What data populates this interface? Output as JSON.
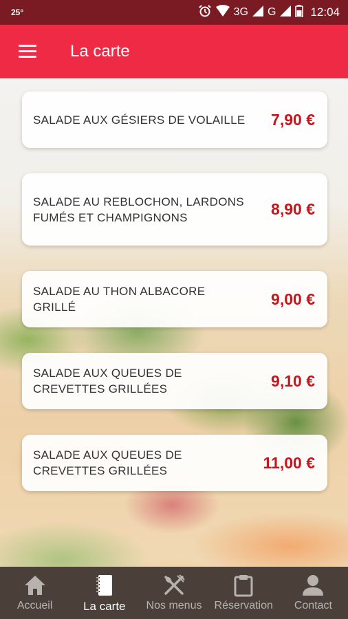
{
  "status_bar": {
    "temperature": "25°",
    "network_3g": "3G",
    "network_g": "G",
    "time": "12:04"
  },
  "app_bar": {
    "title": "La carte"
  },
  "menu_items": [
    {
      "name": "SALADE AUX GÉSIERS DE VOLAILLE",
      "price": "7,90 €"
    },
    {
      "name": "SALADE AU REBLOCHON, LARDONS FUMÉS ET CHAMPIGNONS",
      "price": "8,90 €"
    },
    {
      "name": "SALADE AU THON ALBACORE GRILLÉ",
      "price": "9,00 €"
    },
    {
      "name": "SALADE AUX QUEUES DE CREVETTES GRILLÉES",
      "price": "9,10 €"
    },
    {
      "name": "SALADE AUX QUEUES DE CREVETTES GRILLÉES",
      "price": "11,00 €"
    }
  ],
  "bottom_nav": [
    {
      "label": "Accueil",
      "icon": "home-icon",
      "active": false
    },
    {
      "label": "La carte",
      "icon": "notebook-icon",
      "active": true
    },
    {
      "label": "Nos menus",
      "icon": "cutlery-icon",
      "active": false
    },
    {
      "label": "Réservation",
      "icon": "clipboard-icon",
      "active": false
    },
    {
      "label": "Contact",
      "icon": "person-icon",
      "active": false
    }
  ],
  "colors": {
    "status_bar": "#7a1a22",
    "app_bar": "#ee2a45",
    "price": "#c4161c",
    "bottom_nav": "#4a4039"
  }
}
